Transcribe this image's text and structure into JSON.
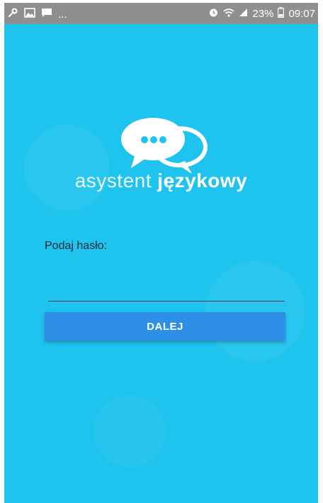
{
  "status_bar": {
    "left_icons": [
      "wrench-icon",
      "image-icon",
      "message-icon"
    ],
    "overflow": "...",
    "battery": "23%",
    "time": "09:07"
  },
  "brand": {
    "prefix": "asystent ",
    "suffix": "językowy"
  },
  "form": {
    "password_label": "Podaj hasło:",
    "password_value": "",
    "submit_label": "DALEJ"
  },
  "colors": {
    "app_background": "#1ec3ee",
    "button": "#2e8fe6",
    "status_bar": "#8f8f8f"
  }
}
